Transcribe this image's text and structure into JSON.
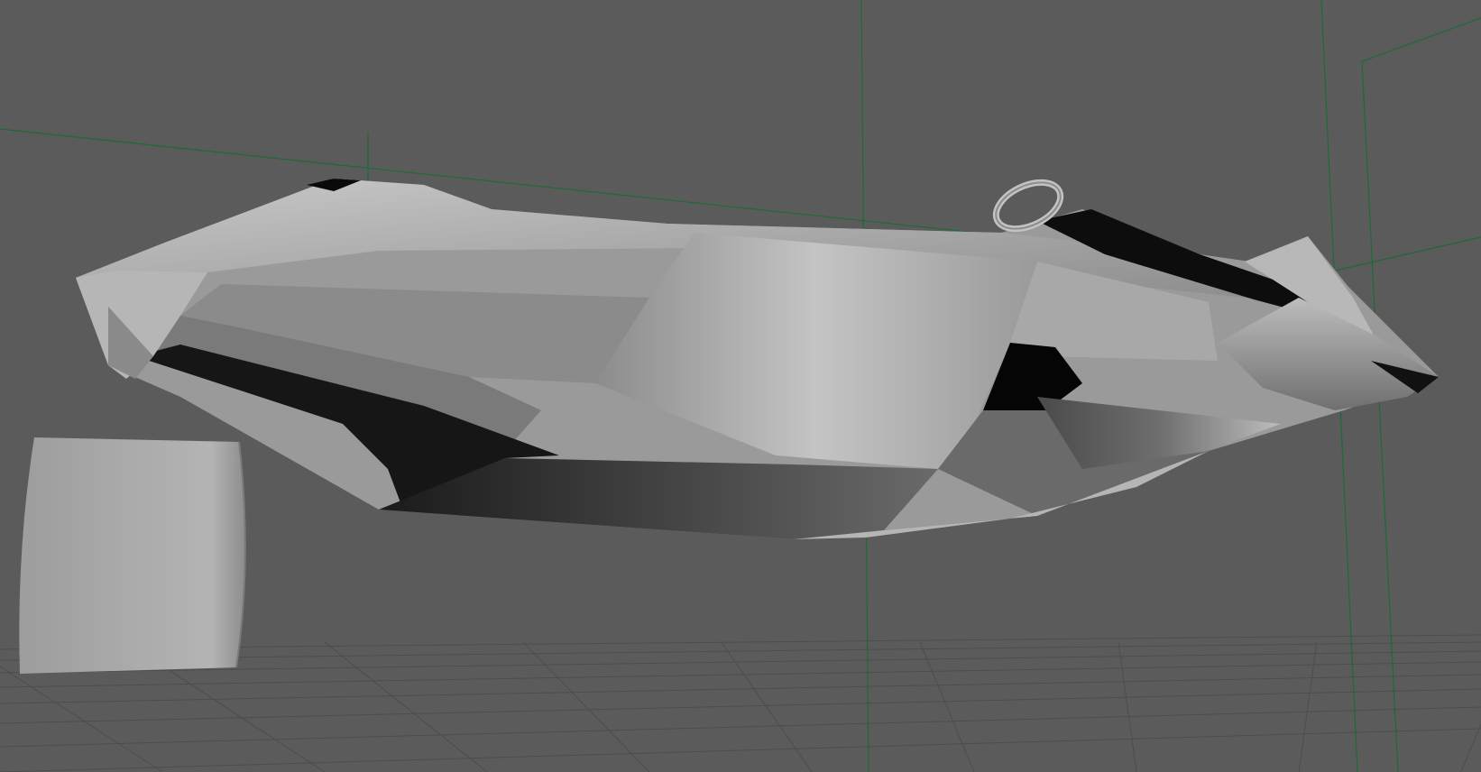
{
  "viewport": {
    "background": "#5b5b5b",
    "shading": "smooth-shaded",
    "objects": [
      {
        "name": "car-body",
        "kind": "polygon-mesh"
      },
      {
        "name": "steering-wheel",
        "kind": "torus"
      },
      {
        "name": "wheel",
        "kind": "cylinder"
      }
    ],
    "helpers": [
      {
        "name": "ground-grid"
      },
      {
        "name": "camera-guides",
        "color": "#1e6a36"
      }
    ]
  }
}
